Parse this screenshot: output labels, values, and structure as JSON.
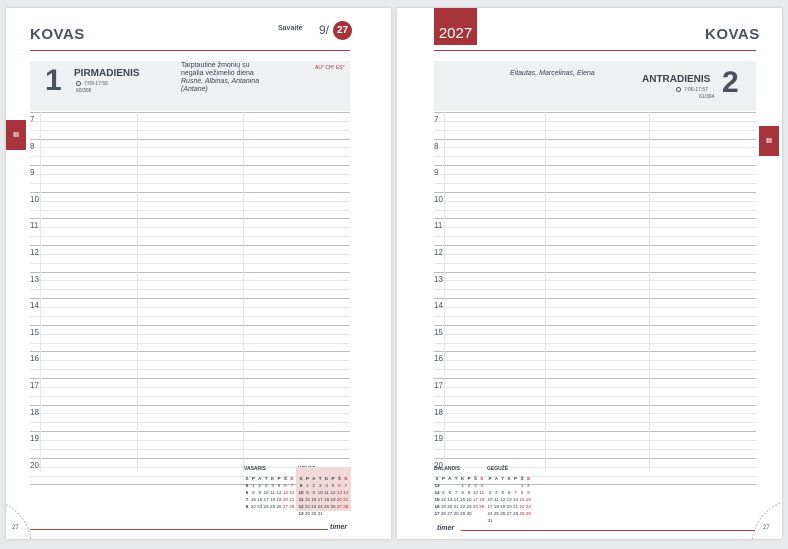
{
  "left": {
    "month": "KOVAS",
    "week_label": "Savaitė",
    "week_num": "9/",
    "week_circle": "27",
    "day_number": "1",
    "day_name": "PIRMADIENIS",
    "sun": "7:09-17:55",
    "day_count": "60/305",
    "holiday_line1": "Tarptautinė žmonių su",
    "holiday_line2": "negalia vežimėlio diena",
    "names_line1": "Rusnė, Albinas, Antanina",
    "names_line2": "(Antanė)",
    "moon": "AU° CH° ES°",
    "tab": "III",
    "page_number": "27",
    "brand": "timer"
  },
  "right": {
    "year": "2027",
    "month": "KOVAS",
    "day_number": "2",
    "day_name": "ANTRADIENIS",
    "sun": "7:06-17:57",
    "day_count": "61/304",
    "names": "Eitautas, Marcelinas, Elena",
    "tab": "III",
    "page_number": "27",
    "brand": "timer"
  },
  "hours": [
    "7",
    "8",
    "9",
    "10",
    "11",
    "12",
    "13",
    "14",
    "15",
    "16",
    "17",
    "18",
    "19",
    "20"
  ],
  "mini_calendars": [
    {
      "title": "VASARIS",
      "weekdays": [
        "S",
        "P",
        "A",
        "T",
        "K",
        "P",
        "Š",
        "S"
      ],
      "rows": [
        [
          "5",
          "1",
          "2",
          "3",
          "4",
          "5",
          "6",
          "7"
        ],
        [
          "6",
          "8",
          "9",
          "10",
          "11",
          "12",
          "13",
          "14"
        ],
        [
          "7",
          "15",
          "16",
          "17",
          "18",
          "19",
          "20",
          "21"
        ],
        [
          "8",
          "22",
          "23",
          "24",
          "25",
          "26",
          "27",
          "28"
        ]
      ]
    },
    {
      "title": "KOVAS",
      "weekdays": [
        "S",
        "P",
        "A",
        "T",
        "K",
        "P",
        "Š",
        "S"
      ],
      "rows": [
        [
          "9",
          "1",
          "2",
          "3",
          "4",
          "5",
          "6",
          "7"
        ],
        [
          "10",
          "8",
          "9",
          "10",
          "11",
          "12",
          "13",
          "14"
        ],
        [
          "11",
          "15",
          "16",
          "17",
          "18",
          "19",
          "20",
          "21"
        ],
        [
          "12",
          "22",
          "23",
          "24",
          "25",
          "26",
          "27",
          "28"
        ],
        [
          "13",
          "29",
          "30",
          "31",
          "",
          "",
          "",
          ""
        ]
      ]
    },
    {
      "title": "BALANDIS",
      "weekdays": [
        "S",
        "P",
        "A",
        "T",
        "K",
        "P",
        "Š",
        "S"
      ],
      "rows": [
        [
          "13",
          "",
          "",
          "",
          "1",
          "2",
          "3",
          "4"
        ],
        [
          "14",
          "5",
          "6",
          "7",
          "8",
          "9",
          "10",
          "11"
        ],
        [
          "15",
          "12",
          "13",
          "14",
          "15",
          "16",
          "17",
          "18"
        ],
        [
          "16",
          "19",
          "20",
          "21",
          "22",
          "23",
          "24",
          "25"
        ],
        [
          "17",
          "26",
          "27",
          "28",
          "29",
          "30",
          "",
          ""
        ]
      ]
    },
    {
      "title": "GEGUŽĖ",
      "weekdays": [
        "P",
        "A",
        "T",
        "K",
        "P",
        "Š",
        "S"
      ],
      "rows": [
        [
          "",
          "",
          "",
          "",
          "",
          "1",
          "2"
        ],
        [
          "3",
          "4",
          "5",
          "6",
          "7",
          "8",
          "9"
        ],
        [
          "10",
          "11",
          "12",
          "13",
          "14",
          "15",
          "16"
        ],
        [
          "17",
          "18",
          "19",
          "20",
          "21",
          "22",
          "23"
        ],
        [
          "24",
          "25",
          "26",
          "27",
          "28",
          "29",
          "30"
        ],
        [
          "31",
          "",
          "",
          "",
          "",
          "",
          ""
        ]
      ]
    }
  ]
}
